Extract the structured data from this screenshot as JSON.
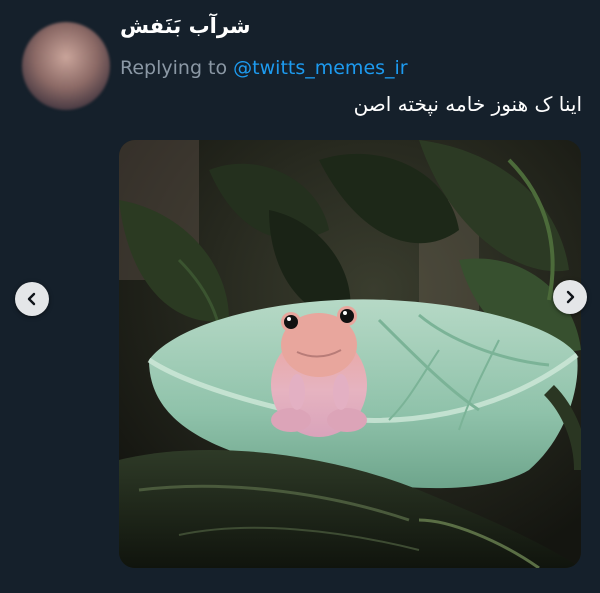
{
  "tweet": {
    "display_name": "شرآب بَنَفش",
    "replying_to_label": "Replying to",
    "replying_to_handle": "@twitts_memes_ir",
    "text": "اینا ک هنوز خامه نپخته اصن"
  },
  "media": {
    "nav_prev_icon": "chevron-left-icon",
    "nav_next_icon": "chevron-right-icon"
  },
  "colors": {
    "background": "#15202b",
    "mention": "#1d9bf0",
    "secondary_text": "#8b98a5",
    "primary_text": "#ffffff"
  }
}
